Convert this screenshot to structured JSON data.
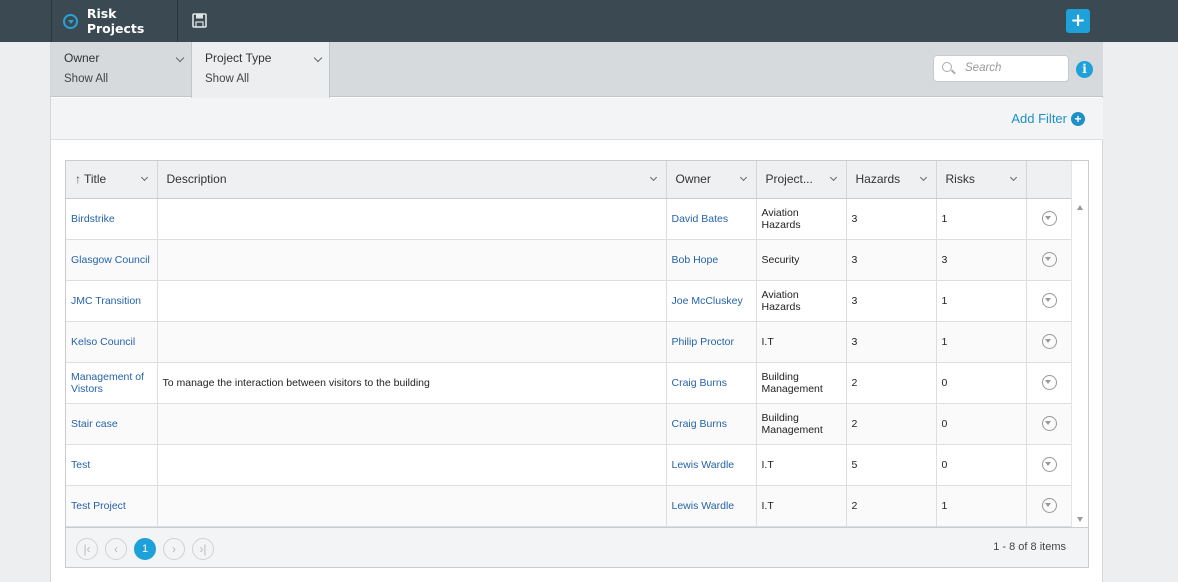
{
  "header": {
    "title": "Risk Projects",
    "add_label": "+"
  },
  "filters": [
    {
      "label": "Owner",
      "value": "Show All"
    },
    {
      "label": "Project Type",
      "value": "Show All"
    }
  ],
  "search": {
    "placeholder": "Search"
  },
  "toolbar": {
    "add_filter_label": "Add Filter"
  },
  "grid": {
    "columns": [
      "Title",
      "Description",
      "Owner",
      "Project...",
      "Hazards",
      "Risks"
    ],
    "sort_indicator": "↑",
    "rows": [
      {
        "title": "Birdstrike",
        "description": "",
        "owner": "David Bates",
        "type": "Aviation Hazards",
        "hazards": "3",
        "risks": "1"
      },
      {
        "title": "Glasgow Council",
        "description": "",
        "owner": "Bob Hope",
        "type": "Security",
        "hazards": "3",
        "risks": "3"
      },
      {
        "title": "JMC Transition",
        "description": "",
        "owner": "Joe McCluskey",
        "type": "Aviation Hazards",
        "hazards": "3",
        "risks": "1"
      },
      {
        "title": "Kelso Council",
        "description": "",
        "owner": "Philip Proctor",
        "type": "I.T",
        "hazards": "3",
        "risks": "1"
      },
      {
        "title": "Management of Vistors",
        "description": "To manage the interaction between visitors to the building",
        "owner": "Craig Burns",
        "type": "Building Management",
        "hazards": "2",
        "risks": "0"
      },
      {
        "title": "Stair case",
        "description": "",
        "owner": "Craig Burns",
        "type": "Building Management",
        "hazards": "2",
        "risks": "0"
      },
      {
        "title": "Test",
        "description": "",
        "owner": "Lewis Wardle",
        "type": "I.T",
        "hazards": "5",
        "risks": "0"
      },
      {
        "title": "Test Project",
        "description": "",
        "owner": "Lewis Wardle",
        "type": "I.T",
        "hazards": "2",
        "risks": "1"
      }
    ]
  },
  "pager": {
    "first": "|‹",
    "prev": "‹",
    "current": "1",
    "next": "›",
    "last": "›|",
    "info": "1 - 8 of 8 items"
  },
  "colors": {
    "topbar": "#3b4a52",
    "accent": "#1ea1d8",
    "link": "#2563a8"
  }
}
